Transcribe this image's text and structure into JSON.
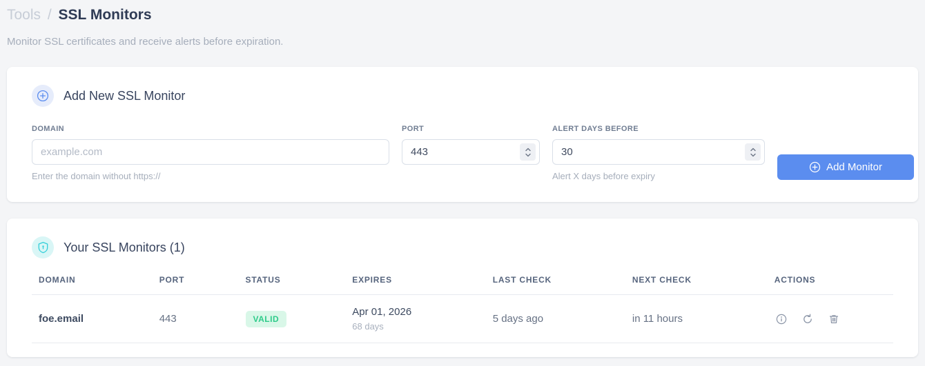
{
  "page": {
    "breadcrumb": {
      "section": "Tools",
      "separator": "/",
      "current": "SSL Monitors"
    },
    "subtitle": "Monitor SSL certificates and receive alerts before expiration."
  },
  "add_monitor_card": {
    "title": "Add New SSL Monitor",
    "fields": {
      "domain": {
        "label": "DOMAIN",
        "placeholder": "example.com",
        "value": "",
        "helper": "Enter the domain without https://"
      },
      "port": {
        "label": "PORT",
        "value": "443"
      },
      "alert_days": {
        "label": "ALERT DAYS BEFORE",
        "value": "30",
        "helper": "Alert X days before expiry"
      }
    },
    "submit_label": "Add Monitor"
  },
  "monitors_card": {
    "title": "Your SSL Monitors (1)",
    "table": {
      "headers": [
        "DOMAIN",
        "PORT",
        "STATUS",
        "EXPIRES",
        "LAST CHECK",
        "NEXT CHECK",
        "ACTIONS"
      ],
      "rows": [
        {
          "domain": "foe.email",
          "port": "443",
          "status": "VALID",
          "expires_date": "Apr 01, 2026",
          "expires_days": "68 days",
          "last_check": "5 days ago",
          "next_check": "in 11 hours"
        }
      ]
    }
  },
  "icons": {
    "add_header": "plus-circle-icon",
    "shield_header": "shield-icon",
    "button_plus": "plus-circle-icon",
    "row_actions": [
      "info-icon",
      "refresh-icon",
      "trash-icon"
    ]
  },
  "colors": {
    "accent_blue": "#5b8def",
    "valid_green": "#2ecb8a",
    "valid_green_bg": "#d9f7e8",
    "cyan_icon": "#33cfd9",
    "page_bg": "#f4f5f7",
    "next_check_blue": "#6a93ee"
  }
}
